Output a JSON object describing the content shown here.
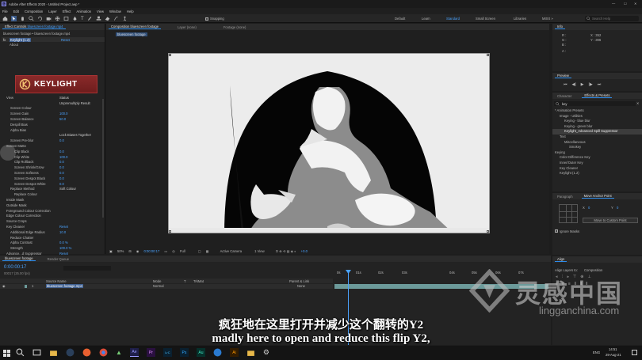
{
  "titlebar": {
    "title": "Adobe After Effects 2020 - Untitled Project.aep *"
  },
  "menu": [
    "File",
    "Edit",
    "Composition",
    "Layer",
    "Effect",
    "Animation",
    "View",
    "Window",
    "Help"
  ],
  "toolbar": {
    "snapping_label": "Snapping",
    "workspaces": [
      "Default",
      "Learn",
      "Standard",
      "Small Screen",
      "Libraries"
    ],
    "more": "MIXX »",
    "search_placeholder": "Search Help"
  },
  "effect_controls": {
    "tab": "Effect Controls",
    "tab_layer": "bluescreen footage.mp4",
    "breadcrumb": "bluescreen footage • bluescreen footage.mp4",
    "effect_name": "Keylight (1.2)",
    "reset": "Reset",
    "about": "About",
    "logo_text": "KEYLIGHT",
    "rows": [
      {
        "label": "View",
        "value": "Status",
        "indent": 0
      },
      {
        "label": "",
        "value": "Unpremultiply Result",
        "indent": 0
      },
      {
        "label": "Screen Colour",
        "value": "",
        "indent": 1
      },
      {
        "label": "Screen Gain",
        "value": "100.0",
        "indent": 1
      },
      {
        "label": "Screen Balance",
        "value": "50.0",
        "indent": 1
      },
      {
        "label": "Despill Bias",
        "value": "",
        "indent": 1
      },
      {
        "label": "Alpha Bias",
        "value": "",
        "indent": 1
      },
      {
        "label": "",
        "value": "Lock Biases Together",
        "indent": 0
      },
      {
        "label": "Screen Pre-blur",
        "value": "0.0",
        "indent": 1
      },
      {
        "label": "Screen Matte",
        "value": "",
        "indent": 0
      },
      {
        "label": "Clip Black",
        "value": "0.0",
        "indent": 2
      },
      {
        "label": "Clip White",
        "value": "100.0",
        "indent": 2
      },
      {
        "label": "Clip Rollback",
        "value": "0.0",
        "indent": 2
      },
      {
        "label": "Screen Shrink/Grow",
        "value": "0.0",
        "indent": 2
      },
      {
        "label": "Screen Softness",
        "value": "0.0",
        "indent": 2
      },
      {
        "label": "Screen Despot Black",
        "value": "0.0",
        "indent": 2
      },
      {
        "label": "Screen Despot White",
        "value": "0.0",
        "indent": 2
      },
      {
        "label": "Replace Method",
        "value": "Soft Colour",
        "indent": 1
      },
      {
        "label": "Replace Colour",
        "value": "",
        "indent": 2
      },
      {
        "label": "Inside Mask",
        "value": "",
        "indent": 0
      },
      {
        "label": "Outside Mask",
        "value": "",
        "indent": 0
      },
      {
        "label": "Foreground Colour Correction",
        "value": "",
        "indent": 0
      },
      {
        "label": "Edge Colour Correction",
        "value": "",
        "indent": 0
      },
      {
        "label": "Source Crops",
        "value": "",
        "indent": 0
      },
      {
        "label": "Key Cleaner",
        "value": "Reset",
        "indent": 0
      },
      {
        "label": "Additional Edge Radius",
        "value": "10.0",
        "indent": 1
      },
      {
        "label": "Reduce Chatter",
        "value": "",
        "indent": 1
      },
      {
        "label": "Alpha Contrast",
        "value": "0.0 %",
        "indent": 1
      },
      {
        "label": "Strength",
        "value": "100.0 %",
        "indent": 1
      },
      {
        "label": "Advance...d Suppressor",
        "value": "Reset",
        "indent": 0
      },
      {
        "label": "Method",
        "value": "Standard",
        "indent": 1
      },
      {
        "label": "Suppression",
        "value": "100.0 %",
        "indent": 1
      }
    ]
  },
  "composition": {
    "tab": "Composition bluescreen footage",
    "tab_layer": "Layer (none)",
    "tab_footage": "Footage (none)",
    "breadcrumb": "bluescreen footage",
    "zoom": "50%",
    "timecode": "0:00:00:17",
    "resolution": "Full",
    "camera": "Active Camera",
    "views": "1 View",
    "exposure": "+0.0"
  },
  "info": {
    "tab": "Info",
    "r": "R :",
    "g": "G :",
    "b": "B :",
    "a": "A :",
    "x": "X : 352",
    "y": "Y : 396"
  },
  "preview": {
    "tab": "Preview"
  },
  "effects_presets": {
    "tab_character": "Character",
    "tab_effects": "Effects & Presets",
    "search_value": "key",
    "items": [
      {
        "label": "* Animation Presets",
        "depth": 0
      },
      {
        "label": "Image - Utilities",
        "depth": 1
      },
      {
        "label": "Keying - blue blur",
        "depth": 2
      },
      {
        "label": "Keying - green blur",
        "depth": 2
      },
      {
        "label": "Keylight_Advanced Spill Suppressor",
        "depth": 2
      },
      {
        "label": "Text",
        "depth": 1
      },
      {
        "label": "Miscellaneous",
        "depth": 2
      },
      {
        "label": "Smokey",
        "depth": 3
      },
      {
        "label": "Keying",
        "depth": 0
      },
      {
        "label": "Color Difference Key",
        "depth": 1
      },
      {
        "label": "Inner/Outer Key",
        "depth": 1
      },
      {
        "label": "Key Cleaner",
        "depth": 1
      },
      {
        "label": "Keylight (1.2)",
        "depth": 1
      }
    ]
  },
  "paragraph": {
    "tab": "Paragraph",
    "tab2": "Move Anchor Point",
    "x_label": "X",
    "x_val": "0",
    "y_label": "Y",
    "y_val": "0",
    "button": "Move to Custom Point",
    "ignore_masks": "Ignore Masks"
  },
  "align": {
    "tab": "Align",
    "align_to_label": "Align Layers to:",
    "align_to_value": "Composition"
  },
  "timeline": {
    "tab": "bluescreen footage",
    "tab2": "Render Queue",
    "timecode": "0:00:00:17",
    "frames": "00017 (25.00 fps)",
    "columns": [
      "Source Name",
      "Mode",
      "T",
      "TrkMat",
      "Parent & Link"
    ],
    "layer": {
      "index": "1",
      "name": "bluescreen footage.mp4",
      "mode": "Normal",
      "parent": "None"
    },
    "ruler": [
      "0s",
      "01s",
      "02s",
      "03s",
      "04s",
      "05s",
      "06s",
      "07s"
    ]
  },
  "subtitles": {
    "zh": "疯狂地在这里打开并减少这个翻转的Y2",
    "en": "madly here to open and reduce this flip Y2,"
  },
  "watermark": {
    "brand": "灵感中国",
    "url": "lingganchina.com"
  },
  "taskbar": {
    "lang": "ENG",
    "time": "14:51",
    "date": "29-Aug-21",
    "apps": [
      "Ae",
      "Pr",
      "LrC",
      "Ps",
      "Au",
      "Ai"
    ]
  },
  "colors": {
    "accent": "#2d8ceb",
    "ae_purple": "#9999ff",
    "timeline_bar": "#6c9a9a"
  }
}
